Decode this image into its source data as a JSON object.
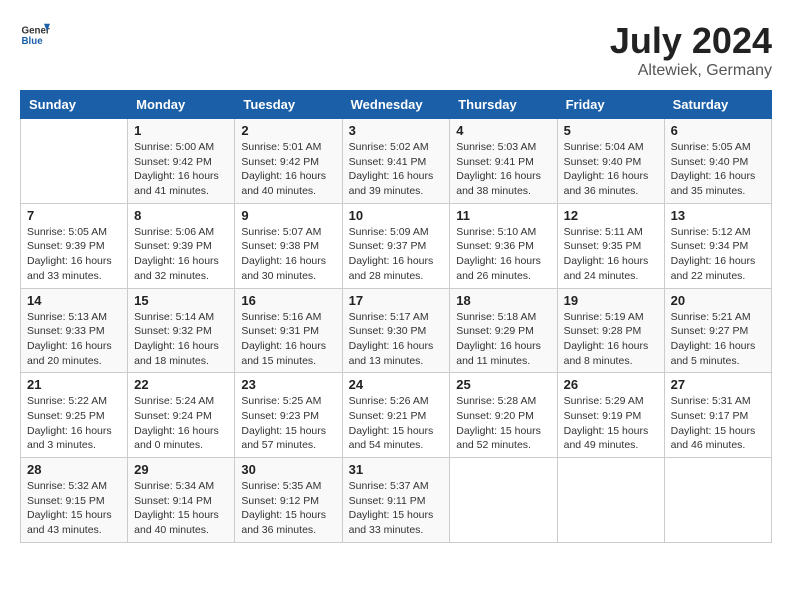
{
  "header": {
    "logo": {
      "general": "General",
      "blue": "Blue"
    },
    "title": "July 2024",
    "location": "Altewiek, Germany"
  },
  "days_of_week": [
    "Sunday",
    "Monday",
    "Tuesday",
    "Wednesday",
    "Thursday",
    "Friday",
    "Saturday"
  ],
  "weeks": [
    [
      {
        "day": "",
        "info": ""
      },
      {
        "day": "1",
        "info": "Sunrise: 5:00 AM\nSunset: 9:42 PM\nDaylight: 16 hours\nand 41 minutes."
      },
      {
        "day": "2",
        "info": "Sunrise: 5:01 AM\nSunset: 9:42 PM\nDaylight: 16 hours\nand 40 minutes."
      },
      {
        "day": "3",
        "info": "Sunrise: 5:02 AM\nSunset: 9:41 PM\nDaylight: 16 hours\nand 39 minutes."
      },
      {
        "day": "4",
        "info": "Sunrise: 5:03 AM\nSunset: 9:41 PM\nDaylight: 16 hours\nand 38 minutes."
      },
      {
        "day": "5",
        "info": "Sunrise: 5:04 AM\nSunset: 9:40 PM\nDaylight: 16 hours\nand 36 minutes."
      },
      {
        "day": "6",
        "info": "Sunrise: 5:05 AM\nSunset: 9:40 PM\nDaylight: 16 hours\nand 35 minutes."
      }
    ],
    [
      {
        "day": "7",
        "info": "Sunrise: 5:05 AM\nSunset: 9:39 PM\nDaylight: 16 hours\nand 33 minutes."
      },
      {
        "day": "8",
        "info": "Sunrise: 5:06 AM\nSunset: 9:39 PM\nDaylight: 16 hours\nand 32 minutes."
      },
      {
        "day": "9",
        "info": "Sunrise: 5:07 AM\nSunset: 9:38 PM\nDaylight: 16 hours\nand 30 minutes."
      },
      {
        "day": "10",
        "info": "Sunrise: 5:09 AM\nSunset: 9:37 PM\nDaylight: 16 hours\nand 28 minutes."
      },
      {
        "day": "11",
        "info": "Sunrise: 5:10 AM\nSunset: 9:36 PM\nDaylight: 16 hours\nand 26 minutes."
      },
      {
        "day": "12",
        "info": "Sunrise: 5:11 AM\nSunset: 9:35 PM\nDaylight: 16 hours\nand 24 minutes."
      },
      {
        "day": "13",
        "info": "Sunrise: 5:12 AM\nSunset: 9:34 PM\nDaylight: 16 hours\nand 22 minutes."
      }
    ],
    [
      {
        "day": "14",
        "info": "Sunrise: 5:13 AM\nSunset: 9:33 PM\nDaylight: 16 hours\nand 20 minutes."
      },
      {
        "day": "15",
        "info": "Sunrise: 5:14 AM\nSunset: 9:32 PM\nDaylight: 16 hours\nand 18 minutes."
      },
      {
        "day": "16",
        "info": "Sunrise: 5:16 AM\nSunset: 9:31 PM\nDaylight: 16 hours\nand 15 minutes."
      },
      {
        "day": "17",
        "info": "Sunrise: 5:17 AM\nSunset: 9:30 PM\nDaylight: 16 hours\nand 13 minutes."
      },
      {
        "day": "18",
        "info": "Sunrise: 5:18 AM\nSunset: 9:29 PM\nDaylight: 16 hours\nand 11 minutes."
      },
      {
        "day": "19",
        "info": "Sunrise: 5:19 AM\nSunset: 9:28 PM\nDaylight: 16 hours\nand 8 minutes."
      },
      {
        "day": "20",
        "info": "Sunrise: 5:21 AM\nSunset: 9:27 PM\nDaylight: 16 hours\nand 5 minutes."
      }
    ],
    [
      {
        "day": "21",
        "info": "Sunrise: 5:22 AM\nSunset: 9:25 PM\nDaylight: 16 hours\nand 3 minutes."
      },
      {
        "day": "22",
        "info": "Sunrise: 5:24 AM\nSunset: 9:24 PM\nDaylight: 16 hours\nand 0 minutes."
      },
      {
        "day": "23",
        "info": "Sunrise: 5:25 AM\nSunset: 9:23 PM\nDaylight: 15 hours\nand 57 minutes."
      },
      {
        "day": "24",
        "info": "Sunrise: 5:26 AM\nSunset: 9:21 PM\nDaylight: 15 hours\nand 54 minutes."
      },
      {
        "day": "25",
        "info": "Sunrise: 5:28 AM\nSunset: 9:20 PM\nDaylight: 15 hours\nand 52 minutes."
      },
      {
        "day": "26",
        "info": "Sunrise: 5:29 AM\nSunset: 9:19 PM\nDaylight: 15 hours\nand 49 minutes."
      },
      {
        "day": "27",
        "info": "Sunrise: 5:31 AM\nSunset: 9:17 PM\nDaylight: 15 hours\nand 46 minutes."
      }
    ],
    [
      {
        "day": "28",
        "info": "Sunrise: 5:32 AM\nSunset: 9:15 PM\nDaylight: 15 hours\nand 43 minutes."
      },
      {
        "day": "29",
        "info": "Sunrise: 5:34 AM\nSunset: 9:14 PM\nDaylight: 15 hours\nand 40 minutes."
      },
      {
        "day": "30",
        "info": "Sunrise: 5:35 AM\nSunset: 9:12 PM\nDaylight: 15 hours\nand 36 minutes."
      },
      {
        "day": "31",
        "info": "Sunrise: 5:37 AM\nSunset: 9:11 PM\nDaylight: 15 hours\nand 33 minutes."
      },
      {
        "day": "",
        "info": ""
      },
      {
        "day": "",
        "info": ""
      },
      {
        "day": "",
        "info": ""
      }
    ]
  ]
}
